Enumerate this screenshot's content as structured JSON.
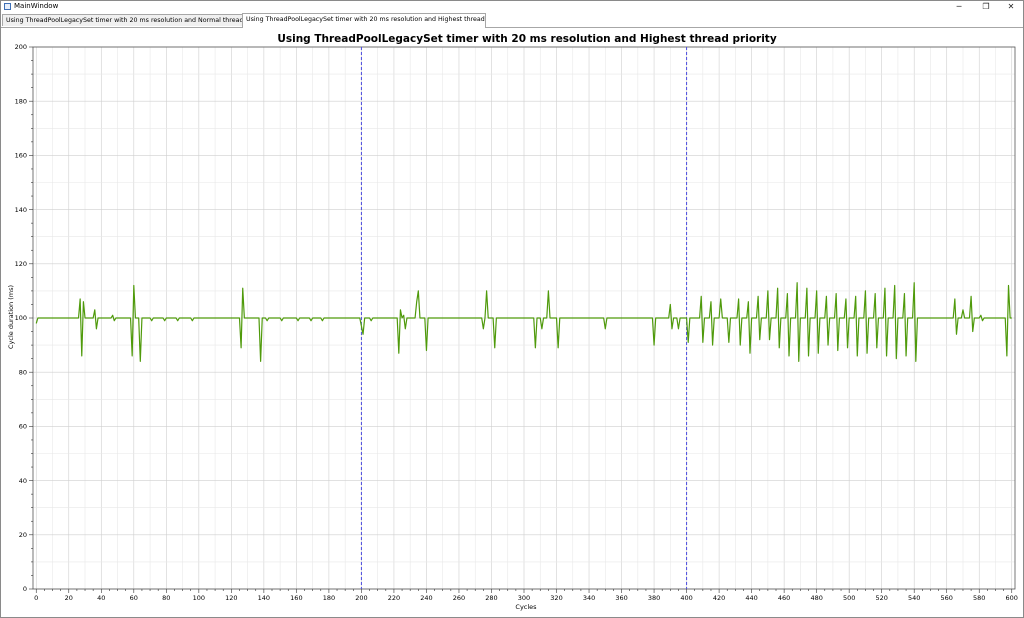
{
  "window": {
    "title": "MainWindow",
    "minimize_label": "─",
    "maximize_label": "❐",
    "close_label": "✕"
  },
  "tabs": [
    {
      "label": "Using ThreadPoolLegacySet timer with 20 ms resolution and Normal thread priority",
      "active": false
    },
    {
      "label": "Using ThreadPoolLegacySet timer with 20 ms resolution and Highest thread priority",
      "active": true
    }
  ],
  "chart_data": {
    "type": "line",
    "title": "Using ThreadPoolLegacySet timer with 20 ms resolution and Highest thread priority",
    "xlabel": "Cycles",
    "ylabel": "Cycle duration (ms)",
    "xlim": [
      -2,
      602
    ],
    "ylim": [
      0,
      200
    ],
    "x_ticks": [
      0,
      20,
      40,
      60,
      80,
      100,
      120,
      140,
      160,
      180,
      200,
      220,
      240,
      260,
      280,
      300,
      320,
      340,
      360,
      380,
      400,
      420,
      440,
      460,
      480,
      500,
      520,
      540,
      560,
      580,
      600
    ],
    "y_ticks": [
      0,
      20,
      40,
      60,
      80,
      100,
      120,
      140,
      160,
      180,
      200
    ],
    "grid": true,
    "series_color": "#4f9a0b",
    "vertical_markers": [
      200,
      400
    ],
    "marker_color": "#4a4adf",
    "series": [
      {
        "points": [
          [
            0,
            98
          ],
          [
            1,
            100
          ],
          [
            26,
            100
          ],
          [
            27,
            107
          ],
          [
            28,
            86
          ],
          [
            29,
            106
          ],
          [
            30,
            100
          ],
          [
            35,
            100
          ],
          [
            36,
            103
          ],
          [
            37,
            96
          ],
          [
            38,
            100
          ],
          [
            46,
            100
          ],
          [
            47,
            101
          ],
          [
            48,
            99
          ],
          [
            49,
            100
          ],
          [
            58,
            100
          ],
          [
            59,
            86
          ],
          [
            60,
            112
          ],
          [
            61,
            100
          ],
          [
            63,
            100
          ],
          [
            64,
            84
          ],
          [
            65,
            100
          ],
          [
            70,
            100
          ],
          [
            71,
            99
          ],
          [
            72,
            100
          ],
          [
            78,
            100
          ],
          [
            79,
            99
          ],
          [
            80,
            100
          ],
          [
            86,
            100
          ],
          [
            87,
            99
          ],
          [
            88,
            100
          ],
          [
            95,
            100
          ],
          [
            96,
            99
          ],
          [
            97,
            100
          ],
          [
            125,
            100
          ],
          [
            126,
            89
          ],
          [
            127,
            111
          ],
          [
            128,
            100
          ],
          [
            137,
            100
          ],
          [
            138,
            84
          ],
          [
            139,
            100
          ],
          [
            141,
            100
          ],
          [
            142,
            99
          ],
          [
            143,
            100
          ],
          [
            150,
            100
          ],
          [
            151,
            99
          ],
          [
            152,
            100
          ],
          [
            160,
            100
          ],
          [
            161,
            99
          ],
          [
            162,
            100
          ],
          [
            168,
            100
          ],
          [
            169,
            99
          ],
          [
            170,
            100
          ],
          [
            175,
            100
          ],
          [
            176,
            99
          ],
          [
            177,
            100
          ],
          [
            199,
            100
          ],
          [
            200,
            97
          ],
          [
            201,
            94
          ],
          [
            202,
            100
          ],
          [
            205,
            100
          ],
          [
            206,
            99
          ],
          [
            207,
            100
          ],
          [
            222,
            100
          ],
          [
            223,
            87
          ],
          [
            224,
            103
          ],
          [
            225,
            100
          ],
          [
            226,
            101
          ],
          [
            227,
            96
          ],
          [
            228,
            100
          ],
          [
            233,
            100
          ],
          [
            234,
            106
          ],
          [
            235,
            110
          ],
          [
            236,
            100
          ],
          [
            239,
            100
          ],
          [
            240,
            88
          ],
          [
            241,
            100
          ],
          [
            274,
            100
          ],
          [
            275,
            96
          ],
          [
            276,
            100
          ],
          [
            277,
            110
          ],
          [
            278,
            100
          ],
          [
            281,
            100
          ],
          [
            282,
            89
          ],
          [
            283,
            100
          ],
          [
            306,
            100
          ],
          [
            307,
            89
          ],
          [
            308,
            100
          ],
          [
            310,
            100
          ],
          [
            311,
            96
          ],
          [
            312,
            100
          ],
          [
            314,
            100
          ],
          [
            315,
            110
          ],
          [
            316,
            100
          ],
          [
            320,
            100
          ],
          [
            321,
            89
          ],
          [
            322,
            100
          ],
          [
            349,
            100
          ],
          [
            350,
            96
          ],
          [
            351,
            100
          ],
          [
            379,
            100
          ],
          [
            380,
            90
          ],
          [
            381,
            100
          ],
          [
            389,
            100
          ],
          [
            390,
            105
          ],
          [
            391,
            96
          ],
          [
            392,
            100
          ],
          [
            394,
            100
          ],
          [
            395,
            96
          ],
          [
            396,
            100
          ],
          [
            399,
            100
          ],
          [
            400,
            100
          ],
          [
            401,
            91
          ],
          [
            402,
            100
          ],
          [
            408,
            100
          ],
          [
            409,
            108
          ],
          [
            410,
            91
          ],
          [
            411,
            100
          ],
          [
            414,
            100
          ],
          [
            415,
            106
          ],
          [
            416,
            90
          ],
          [
            417,
            100
          ],
          [
            420,
            100
          ],
          [
            421,
            107
          ],
          [
            422,
            100
          ],
          [
            425,
            100
          ],
          [
            426,
            91
          ],
          [
            427,
            100
          ],
          [
            431,
            100
          ],
          [
            432,
            107
          ],
          [
            433,
            90
          ],
          [
            434,
            100
          ],
          [
            437,
            100
          ],
          [
            438,
            106
          ],
          [
            439,
            87
          ],
          [
            440,
            100
          ],
          [
            443,
            100
          ],
          [
            444,
            108
          ],
          [
            445,
            92
          ],
          [
            446,
            100
          ],
          [
            449,
            100
          ],
          [
            450,
            110
          ],
          [
            451,
            92
          ],
          [
            452,
            100
          ],
          [
            455,
            100
          ],
          [
            456,
            111
          ],
          [
            457,
            89
          ],
          [
            458,
            100
          ],
          [
            461,
            100
          ],
          [
            462,
            109
          ],
          [
            463,
            86
          ],
          [
            464,
            100
          ],
          [
            467,
            100
          ],
          [
            468,
            113
          ],
          [
            469,
            84
          ],
          [
            470,
            100
          ],
          [
            473,
            100
          ],
          [
            474,
            111
          ],
          [
            475,
            86
          ],
          [
            476,
            100
          ],
          [
            479,
            100
          ],
          [
            480,
            110
          ],
          [
            481,
            87
          ],
          [
            482,
            100
          ],
          [
            485,
            100
          ],
          [
            486,
            108
          ],
          [
            487,
            90
          ],
          [
            488,
            100
          ],
          [
            491,
            100
          ],
          [
            492,
            109
          ],
          [
            493,
            88
          ],
          [
            494,
            100
          ],
          [
            497,
            100
          ],
          [
            498,
            107
          ],
          [
            499,
            89
          ],
          [
            500,
            100
          ],
          [
            503,
            100
          ],
          [
            504,
            108
          ],
          [
            505,
            86
          ],
          [
            506,
            100
          ],
          [
            509,
            100
          ],
          [
            510,
            110
          ],
          [
            511,
            87
          ],
          [
            512,
            100
          ],
          [
            515,
            100
          ],
          [
            516,
            109
          ],
          [
            517,
            89
          ],
          [
            518,
            100
          ],
          [
            521,
            100
          ],
          [
            522,
            111
          ],
          [
            523,
            86
          ],
          [
            524,
            100
          ],
          [
            527,
            100
          ],
          [
            528,
            112
          ],
          [
            529,
            85
          ],
          [
            530,
            100
          ],
          [
            533,
            100
          ],
          [
            534,
            109
          ],
          [
            535,
            86
          ],
          [
            536,
            100
          ],
          [
            539,
            100
          ],
          [
            540,
            113
          ],
          [
            541,
            84
          ],
          [
            542,
            100
          ],
          [
            564,
            100
          ],
          [
            565,
            107
          ],
          [
            566,
            94
          ],
          [
            567,
            100
          ],
          [
            569,
            100
          ],
          [
            570,
            103
          ],
          [
            571,
            100
          ],
          [
            574,
            100
          ],
          [
            575,
            108
          ],
          [
            576,
            95
          ],
          [
            577,
            100
          ],
          [
            580,
            100
          ],
          [
            581,
            101
          ],
          [
            582,
            99
          ],
          [
            583,
            100
          ],
          [
            596,
            100
          ],
          [
            597,
            86
          ],
          [
            598,
            112
          ],
          [
            599,
            100
          ],
          [
            600,
            100
          ]
        ]
      }
    ]
  }
}
